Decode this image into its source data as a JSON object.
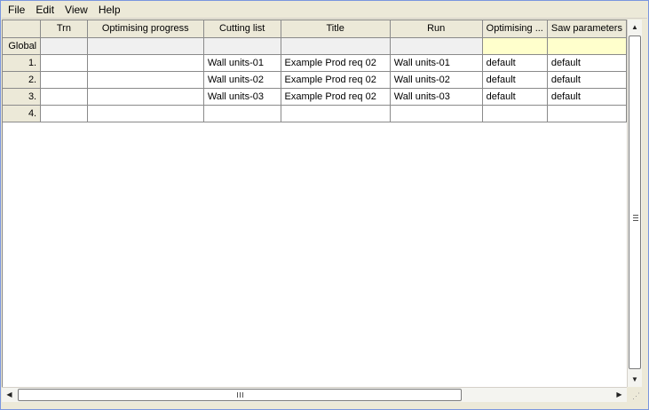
{
  "menu": {
    "items": [
      "File",
      "Edit",
      "View",
      "Help"
    ]
  },
  "grid": {
    "columns": [
      "",
      "Trn",
      "Optimising progress",
      "Cutting list",
      "Title",
      "Run",
      "Optimising ...",
      "Saw parameters"
    ],
    "global_label": "Global",
    "rows": [
      {
        "num": "1.",
        "trn": "",
        "progress": "",
        "cutting_list": "Wall units-01",
        "title": "Example Prod req 02",
        "run": "Wall units-01",
        "optimising": "default",
        "saw": "default"
      },
      {
        "num": "2.",
        "trn": "",
        "progress": "",
        "cutting_list": "Wall units-02",
        "title": "Example Prod req 02",
        "run": "Wall units-02",
        "optimising": "default",
        "saw": "default"
      },
      {
        "num": "3.",
        "trn": "",
        "progress": "",
        "cutting_list": "Wall units-03",
        "title": "Example Prod req 02",
        "run": "Wall units-03",
        "optimising": "default",
        "saw": "default"
      },
      {
        "num": "4.",
        "trn": "",
        "progress": "",
        "cutting_list": "",
        "title": "",
        "run": "",
        "optimising": "",
        "saw": ""
      }
    ]
  },
  "scrollbars": {
    "vertical_position": 0,
    "horizontal_position": 0
  },
  "colors": {
    "global_parameter_highlight": "#ffffcc",
    "header_background": "#ece9d8"
  }
}
